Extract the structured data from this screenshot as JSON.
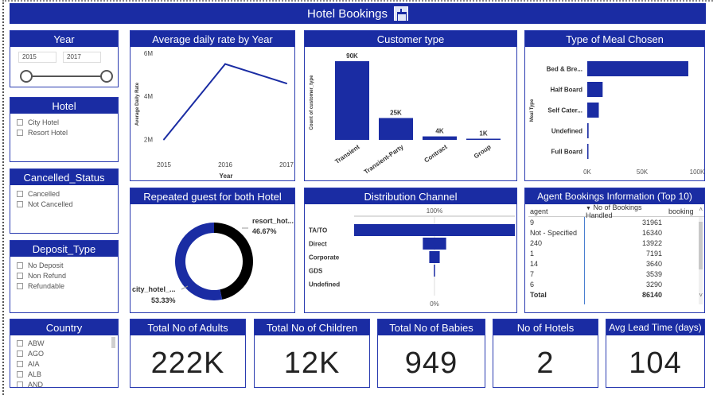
{
  "banner": {
    "title": "Hotel Bookings"
  },
  "year_slicer": {
    "title": "Year",
    "start": "2015",
    "end": "2017"
  },
  "hotel_slicer": {
    "title": "Hotel",
    "items": [
      "City Hotel",
      "Resort Hotel"
    ]
  },
  "cancelled_slicer": {
    "title": "Cancelled_Status",
    "items": [
      "Cancelled",
      "Not Cancelled"
    ]
  },
  "deposit_slicer": {
    "title": "Deposit_Type",
    "items": [
      "No Deposit",
      "Non Refund",
      "Refundable"
    ]
  },
  "country_slicer": {
    "title": "Country",
    "items": [
      "ABW",
      "AGO",
      "AIA",
      "ALB",
      "AND"
    ]
  },
  "adr_chart": {
    "title": "Average daily rate by Year"
  },
  "customer_chart": {
    "title": "Customer type"
  },
  "meal_chart": {
    "title": "Type of Meal Chosen"
  },
  "repeated_chart": {
    "title": "Repeated guest for both Hotel"
  },
  "channel_chart": {
    "title": "Distribution Channel"
  },
  "agent_table": {
    "title": "Agent Bookings Information (Top 10)",
    "columns": [
      "agent",
      "No of Bookings Handled",
      "booking"
    ],
    "rows": [
      {
        "agent": "9",
        "count": "31961"
      },
      {
        "agent": "Not - Specified",
        "count": "16340"
      },
      {
        "agent": "240",
        "count": "13922"
      },
      {
        "agent": "1",
        "count": "7191"
      },
      {
        "agent": "14",
        "count": "3640"
      },
      {
        "agent": "7",
        "count": "3539"
      },
      {
        "agent": "6",
        "count": "3290"
      }
    ],
    "total_label": "Total",
    "total_value": "86140"
  },
  "kpis": [
    {
      "title": "Total No of Adults",
      "value": "222K"
    },
    {
      "title": "Total No of Children",
      "value": "12K"
    },
    {
      "title": "Total No of Babies",
      "value": "949"
    },
    {
      "title": "No of Hotels",
      "value": "2"
    },
    {
      "title": "Avg Lead Time (days)",
      "value": "104"
    }
  ],
  "colors": {
    "primary": "#1a2ca3",
    "dark": "#000000"
  },
  "chart_data": [
    {
      "type": "line",
      "title": "Average daily rate by Year",
      "xlabel": "Year",
      "ylabel": "Average Daily Rate",
      "x": [
        "2015",
        "2016",
        "2017"
      ],
      "values": [
        2000000,
        5500000,
        4600000
      ],
      "yticks": [
        "2M",
        "4M",
        "6M"
      ],
      "ylim": [
        1500000,
        6000000
      ]
    },
    {
      "type": "bar",
      "title": "Customer type",
      "ylabel": "Count of customer_type",
      "categories": [
        "Transient",
        "Transient-Party",
        "Contract",
        "Group"
      ],
      "values": [
        90000,
        25000,
        4000,
        1000
      ],
      "data_labels": [
        "90K",
        "25K",
        "4K",
        "1K"
      ]
    },
    {
      "type": "bar",
      "orientation": "horizontal",
      "title": "Type of Meal Chosen",
      "ylabel": "Meal Type",
      "categories": [
        "Bed & Bre...",
        "Half Board",
        "Self Cater...",
        "Undefined",
        "Full Board"
      ],
      "values": [
        92000,
        14000,
        10500,
        1200,
        800
      ],
      "xticks": [
        "0K",
        "50K",
        "100K"
      ],
      "xlim": [
        0,
        100000
      ]
    },
    {
      "type": "pie",
      "title": "Repeated guest for both Hotel",
      "slices": [
        {
          "label": "resort_hot...",
          "value": 46.67,
          "display": "46.67%",
          "color": "#000000"
        },
        {
          "label": "city_hotel_...",
          "value": 53.33,
          "display": "53.33%",
          "color": "#1a2ca3"
        }
      ]
    },
    {
      "type": "bar",
      "subtype": "funnel",
      "title": "Distribution Channel",
      "categories": [
        "TA/TO",
        "Direct",
        "Corporate",
        "GDS",
        "Undefined"
      ],
      "values": [
        100,
        14.5,
        6.5,
        0.5,
        0
      ],
      "top_label": "100%",
      "bottom_label": "0%"
    }
  ]
}
